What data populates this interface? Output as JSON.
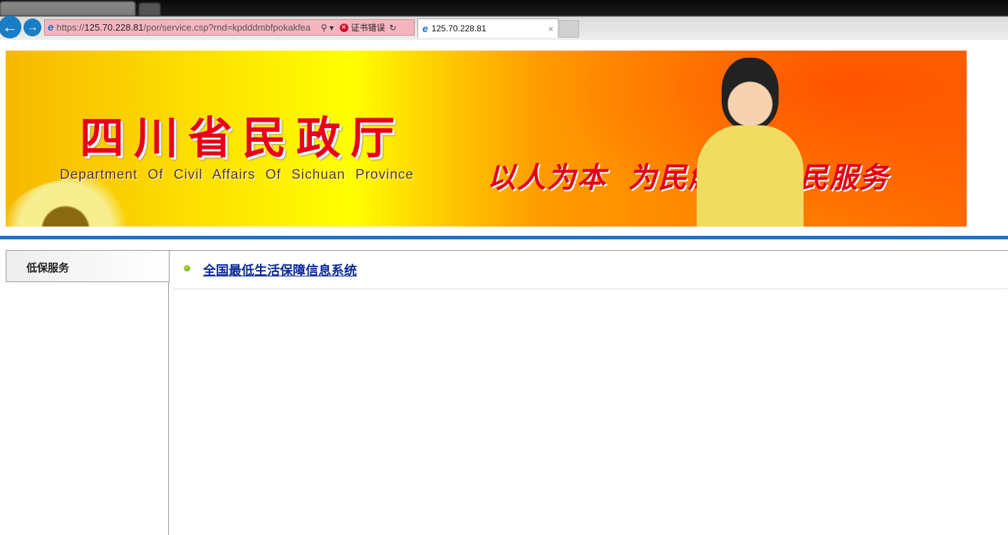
{
  "browser": {
    "url_prefix": "https://",
    "url_host": "125.70.228.81",
    "url_path": "/por/service.csp?rnd=kpdddmbfpokakfea",
    "search_icon": "⚲ ▾",
    "cert_error": "证书错误",
    "refresh_icon": "↻",
    "tab_title": "125.70.228.81",
    "tab_close": "×",
    "back_icon": "←",
    "forward_icon": "→",
    "ie_icon": "e"
  },
  "banner": {
    "title_cn": "四川省民政厅",
    "title_en": "Department Of Civil Affairs Of Sichuan Province",
    "slogan": "以人为本 为民解困 为民服务"
  },
  "sidebar": {
    "tab_label": "低保服务"
  },
  "content": {
    "link": "全国最低生活保障信息系统"
  },
  "colors": {
    "accent_blue": "#1f72c4",
    "link": "#0a2a96",
    "banner_red": "#e8001a"
  }
}
